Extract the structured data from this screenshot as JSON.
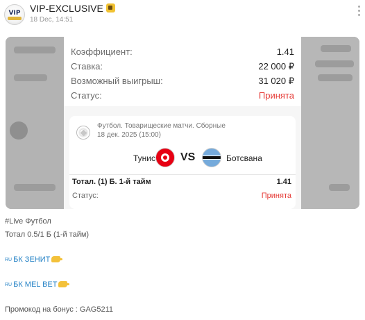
{
  "header": {
    "channel_name": "VIP-EXCLUSIVE",
    "date": "18 Dec, 14:51",
    "avatar_text": "VIP",
    "badge_icon": "money-bag-icon"
  },
  "ticket": {
    "summary": [
      {
        "label": "Коэффициент:",
        "value": "1.41"
      },
      {
        "label": "Ставка:",
        "value": "22 000 ₽"
      },
      {
        "label": "Возможный выигрыш:",
        "value": "31 020 ₽"
      },
      {
        "label": "Статус:",
        "value": "Принята"
      }
    ],
    "match": {
      "league": "Футбол. Товарищеские матчи. Сборные",
      "datetime": "18 дек. 2025 (15:00)",
      "home_team": "Тунис",
      "vs": "VS",
      "away_team": "Ботсвана",
      "market": "Тотал. (1) Б. 1-й тайм",
      "odd": "1.41",
      "status_label": "Статус:",
      "status_value": "Принята"
    }
  },
  "post": {
    "line1": "#Live Футбол",
    "line2": "Тотал 0.5/1 Б (1-й тайм)",
    "flag_text": "RU",
    "link1": "БК ЗЕНИТ",
    "link2": "БК MEL BET",
    "promo": "Промокод на бонус : GAG5211"
  },
  "colors": {
    "accent_link": "#2a85c7",
    "status_accepted": "#e53935"
  }
}
